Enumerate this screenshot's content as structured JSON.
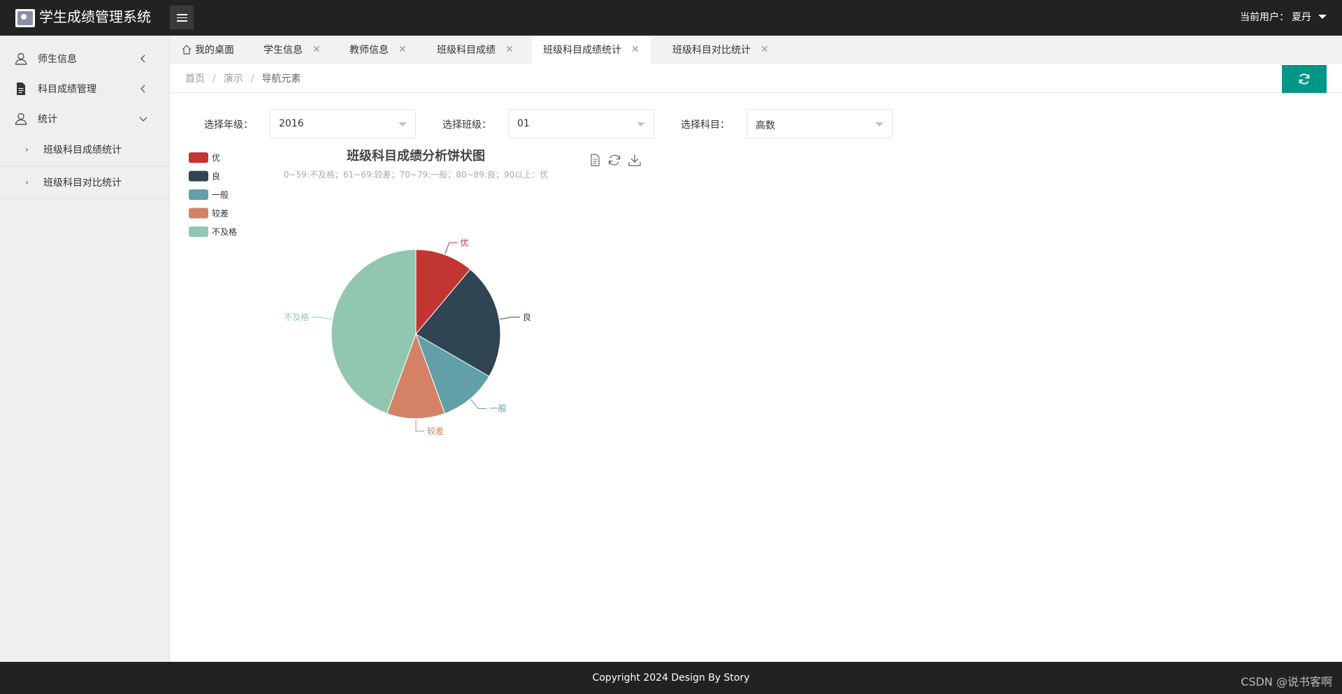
{
  "app": {
    "title": "学生成绩管理系统"
  },
  "header": {
    "user_label": "当前用户：",
    "user_name": "夏丹"
  },
  "sidebar": {
    "items": [
      {
        "label": "师生信息"
      },
      {
        "label": "科目成绩管理"
      },
      {
        "label": "统计"
      }
    ],
    "subitems": [
      {
        "label": "班级科目成绩统计"
      },
      {
        "label": "班级科目对比统计"
      }
    ]
  },
  "tabs": [
    {
      "label": "我的桌面"
    },
    {
      "label": "学生信息"
    },
    {
      "label": "教师信息"
    },
    {
      "label": "班级科目成绩"
    },
    {
      "label": "班级科目成绩统计"
    },
    {
      "label": "班级科目对比统计"
    }
  ],
  "breadcrumb": {
    "home": "首页",
    "demo": "演示",
    "current": "导航元素"
  },
  "filters": {
    "grade_label": "选择年级：",
    "grade_value": "2016",
    "class_label": "选择班级：",
    "class_value": "01",
    "subject_label": "选择科目：",
    "subject_value": "高数"
  },
  "chart_data": {
    "type": "pie",
    "title": "班级科目成绩分析饼状图",
    "subtitle": "0~59:不及格；61~69:较差；70~79:一般；80~89:良；90以上：优",
    "legend_position": "top-left",
    "slices": [
      {
        "name": "优",
        "value": 2,
        "color": "#c23531"
      },
      {
        "name": "良",
        "value": 4,
        "color": "#2f4554"
      },
      {
        "name": "一般",
        "value": 2,
        "color": "#61a0a8"
      },
      {
        "name": "较差",
        "value": 2,
        "color": "#d48265"
      },
      {
        "name": "不及格",
        "value": 8,
        "color": "#91c7ae"
      }
    ]
  },
  "footer": {
    "copyright": "Copyright 2024 Design By Story"
  },
  "watermark": "CSDN @说书客啊",
  "colors": {
    "topbar": "#222222",
    "accent": "#009688"
  }
}
